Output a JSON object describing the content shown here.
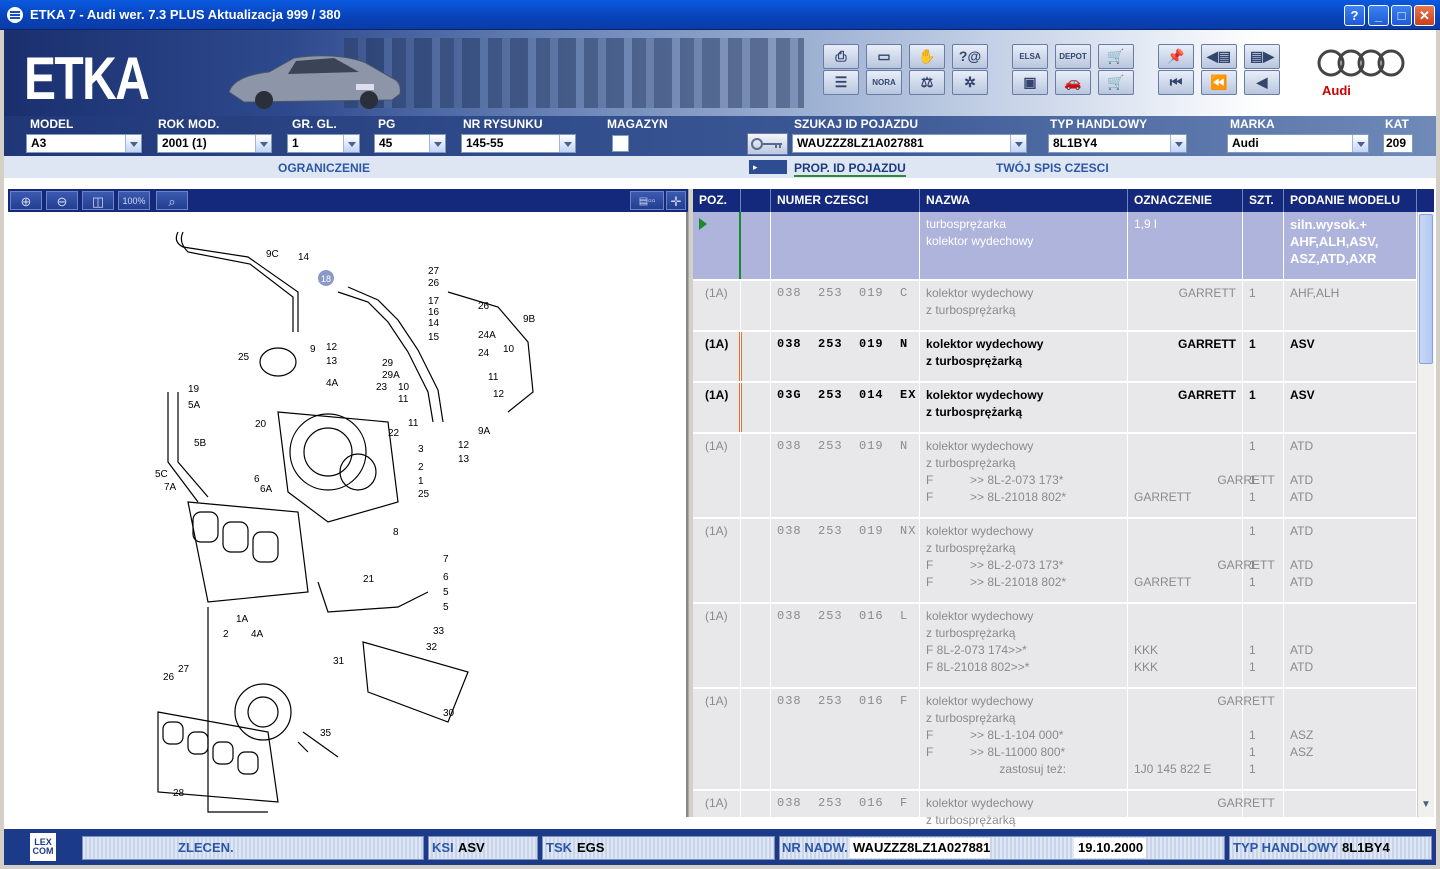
{
  "window": {
    "title": "ETKA 7 - Audi wer. 7.3 PLUS Aktualizacja 999 / 380"
  },
  "banner": {
    "logo": "ETKA",
    "brand": "Audi",
    "toolbar_labels": [
      "ELSA",
      "DEPOT",
      "NORA"
    ]
  },
  "fields": {
    "model": {
      "label": "MODEL",
      "value": "A3"
    },
    "rok": {
      "label": "ROK MOD.",
      "value": "2001 (1)"
    },
    "gr": {
      "label": "GR. GL.",
      "value": "1"
    },
    "pg": {
      "label": "PG",
      "value": "45"
    },
    "nr": {
      "label": "NR RYSUNKU",
      "value": "145-55"
    },
    "magazyn": {
      "label": "MAGAZYN"
    },
    "szukaj": {
      "label": "SZUKAJ ID POJAZDU",
      "value": "WAUZZZ8LZ1A027881"
    },
    "typ": {
      "label": "TYP HANDLOWY",
      "value": "8L1BY4"
    },
    "marka": {
      "label": "MARKA",
      "value": "Audi"
    },
    "kat": {
      "label": "KAT",
      "value": "209"
    }
  },
  "links": {
    "ograniczenie": "OGRANICZENIE",
    "prop": "PROP. ID POJAZDU",
    "spis": "TWÓJ SPIS CZESCI"
  },
  "drawing_tools": [
    "⊕",
    "⊖",
    "◫",
    "100%",
    "🔍"
  ],
  "table": {
    "headers": {
      "poz": "POZ.",
      "numer": "NUMER CZESCI",
      "nazwa": "NAZWA",
      "ozn": "OZNACZENIE",
      "szt": "SZT.",
      "podanie": "PODANIE MODELU"
    },
    "rows": [
      {
        "poz": "",
        "numer": "",
        "nazwa": "turbosprężarka\nkolektor wydechowy",
        "ozn": "1,9 l",
        "szt": "",
        "podanie": "siln.wysok.+\nAHF,ALH,ASV,\nASZ,ATD,AXR"
      },
      {
        "poz": "(1A)",
        "numer": "038  253  019  C",
        "nazwa": "kolektor wydechowy\nz turbosprężarką",
        "ozn": "GARRETT",
        "szt": "1",
        "podanie": "AHF,ALH"
      },
      {
        "poz": "(1A)",
        "numer": "038  253  019  N",
        "nazwa": "kolektor wydechowy\nz turbosprężarką",
        "ozn": "GARRETT",
        "szt": "1",
        "podanie": "ASV"
      },
      {
        "poz": "(1A)",
        "numer": "03G  253  014  EX",
        "nazwa": "kolektor wydechowy\nz turbosprężarką",
        "ozn": "GARRETT",
        "szt": "1",
        "podanie": "ASV"
      },
      {
        "poz": "(1A)",
        "numer": "038  253  019  N",
        "nazwa": "kolektor wydechowy\nz turbosprężarką\nF           >> 8L-2-073 173*\nF           >> 8L-21018 802*",
        "ozn": "\n\n                         GARRETT\nGARRETT",
        "szt": "1\n\n1\n1",
        "podanie": "ATD\n\nATD\nATD"
      },
      {
        "poz": "(1A)",
        "numer": "038  253  019  NX",
        "nazwa": "kolektor wydechowy\nz turbosprężarką\nF           >> 8L-2-073 173*\nF           >> 8L-21018 802*",
        "ozn": "\n\n                         GARRETT\nGARRETT",
        "szt": "1\n\n1\n1",
        "podanie": "ATD\n\nATD\nATD"
      },
      {
        "poz": "(1A)",
        "numer": "038  253  016  L",
        "nazwa": "kolektor wydechowy\nz turbosprężarką\nF 8L-2-073 174>>*\nF 8L-21018 802>>*",
        "ozn": "\n\nKKK\nKKK",
        "szt": "\n\n1\n1",
        "podanie": "\n\nATD\nATD"
      },
      {
        "poz": "(1A)",
        "numer": "038  253  016  F",
        "nazwa": "kolektor wydechowy\nz turbosprężarką\nF           >> 8L-1-104 000*\nF           >> 8L-11000 800*\n                      zastosuj też:",
        "ozn": "                         GARRETT\n\n\n\n1J0 145 822 E",
        "szt": "\n\n1\n1\n1",
        "podanie": "\n\nASZ\nASZ"
      },
      {
        "poz": "(1A)",
        "numer": "038  253  016  F",
        "nazwa": "kolektor wydechowy\nz turbosprężarką",
        "ozn": "                         GARRETT",
        "szt": "",
        "podanie": ""
      }
    ]
  },
  "status": {
    "zlecen": "ZLECEN.",
    "ksi_label": "KSI",
    "ksi": "ASV",
    "tsk_label": "TSK",
    "tsk": "EGS",
    "nr_label": "NR NADW.",
    "nr": "WAUZZZ8LZ1A027881",
    "date": "19.10.2000",
    "typ_label": "TYP HANDLOWY",
    "typ": "8L1BY4",
    "logo": "LEX\nCOM"
  }
}
